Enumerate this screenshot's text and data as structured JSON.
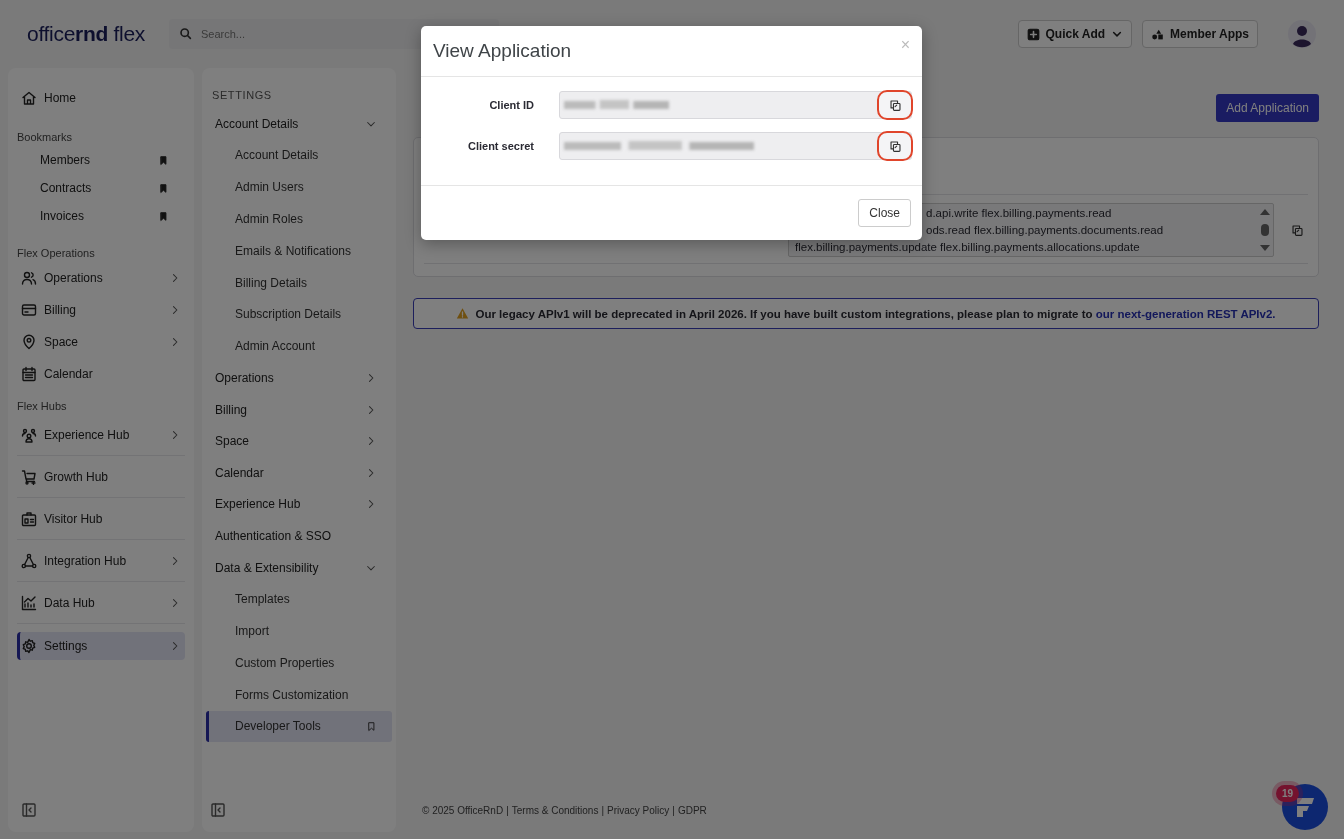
{
  "topbar": {
    "logo": "office**rnd** flex",
    "search": {
      "placeholder": "Search..."
    },
    "quick_add": "Quick Add",
    "member_apps": "Member Apps"
  },
  "nav": [
    {
      "kind": "item",
      "label": "Home",
      "chevron": false,
      "selected": false
    },
    {
      "kind": "heading",
      "label": "Bookmarks"
    },
    {
      "kind": "bookmark",
      "label": "Members"
    },
    {
      "kind": "bookmark",
      "label": "Contracts"
    },
    {
      "kind": "bookmark",
      "label": "Invoices"
    },
    {
      "kind": "heading",
      "label": "Flex Operations"
    },
    {
      "kind": "item",
      "label": "Operations",
      "chevron": true,
      "selected": false
    },
    {
      "kind": "item",
      "label": "Billing",
      "chevron": true,
      "selected": false
    },
    {
      "kind": "item",
      "label": "Space",
      "chevron": true,
      "selected": false
    },
    {
      "kind": "item",
      "label": "Calendar",
      "chevron": false,
      "selected": false
    },
    {
      "kind": "heading",
      "label": "Flex Hubs"
    },
    {
      "kind": "hub",
      "label": "Experience Hub",
      "chevron": true,
      "selected": false
    },
    {
      "kind": "hub",
      "label": "Growth Hub",
      "chevron": false,
      "selected": false
    },
    {
      "kind": "hub",
      "label": "Visitor Hub",
      "chevron": false,
      "selected": false
    },
    {
      "kind": "hub",
      "label": "Integration Hub",
      "chevron": true,
      "selected": false
    },
    {
      "kind": "hub",
      "label": "Data Hub",
      "chevron": true,
      "selected": false
    },
    {
      "kind": "item",
      "label": "Settings",
      "chevron": true,
      "selected": true
    }
  ],
  "settings": {
    "title": "SETTINGS",
    "groups": [
      {
        "kind": "group",
        "label": "Account Details",
        "expanded": true,
        "children": [
          {
            "label": "Account Details",
            "selected": false
          },
          {
            "label": "Admin Users",
            "selected": false
          },
          {
            "label": "Admin Roles",
            "selected": false
          },
          {
            "label": "Emails & Notifications",
            "selected": false
          },
          {
            "label": "Billing Details",
            "selected": false
          },
          {
            "label": "Subscription Details",
            "selected": false
          },
          {
            "label": "Admin Account",
            "selected": false
          }
        ]
      },
      {
        "kind": "group",
        "label": "Operations",
        "expanded": false
      },
      {
        "kind": "group",
        "label": "Billing",
        "expanded": false
      },
      {
        "kind": "group",
        "label": "Space",
        "expanded": false
      },
      {
        "kind": "group",
        "label": "Calendar",
        "expanded": false
      },
      {
        "kind": "group",
        "label": "Experience Hub",
        "expanded": false
      },
      {
        "kind": "link",
        "label": "Authentication & SSO"
      },
      {
        "kind": "group",
        "label": "Data & Extensibility",
        "expanded": true,
        "children": [
          {
            "label": "Templates",
            "selected": false
          },
          {
            "label": "Import",
            "selected": false
          },
          {
            "label": "Custom Properties",
            "selected": false
          },
          {
            "label": "Forms Customization",
            "selected": false
          },
          {
            "label": "Developer Tools",
            "selected": true
          }
        ]
      }
    ]
  },
  "main": {
    "add_button": "Add Application",
    "scopes": [
      "d.api.write flex.billing.payments.read",
      "ods.read flex.billing.payments.documents.read",
      "flex.billing.payments.update flex.billing.payments.allocations.update"
    ],
    "banner": {
      "text": "Our legacy APIv1 will be deprecated in April 2026. If you have built custom integrations, please plan to migrate to",
      "link": "our next-generation REST APIv2."
    }
  },
  "footer": {
    "copyright": "© 2025 OfficeRnD",
    "separator": "|",
    "links": [
      "Terms & Conditions",
      "Privacy Policy",
      "GDPR"
    ]
  },
  "chat": {
    "badge": "19"
  },
  "modal": {
    "title": "View Application",
    "close": "×",
    "fields": [
      {
        "label": "Client ID",
        "highlighted": true
      },
      {
        "label": "Client secret",
        "highlighted": true
      }
    ],
    "button": "Close"
  }
}
